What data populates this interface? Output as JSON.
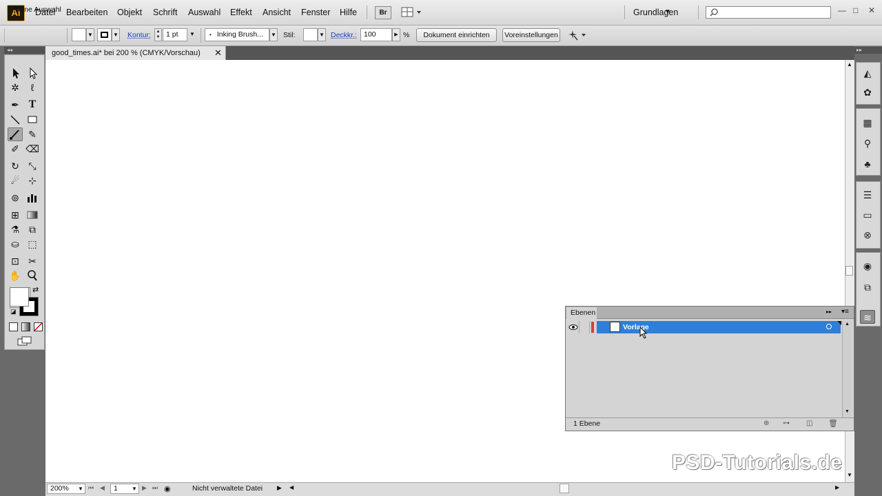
{
  "app": {
    "logo": "Ai"
  },
  "menu": [
    "Datei",
    "Bearbeiten",
    "Objekt",
    "Schrift",
    "Auswahl",
    "Effekt",
    "Ansicht",
    "Fenster",
    "Hilfe"
  ],
  "header": {
    "bridge_label": "Br",
    "workspace": "Grundlagen",
    "search_placeholder": ""
  },
  "controlbar": {
    "selection": "Keine Auswahl",
    "stroke_label": "Kontur:",
    "stroke_weight": "1 pt",
    "brush": "Inking Brush...",
    "style_label": "Stil:",
    "opacity_label": "Deckkr.:",
    "opacity_value": "100",
    "percent": "%",
    "doc_setup": "Dokument einrichten",
    "preferences": "Voreinstellungen"
  },
  "document": {
    "tab_title": "good_times.ai* bei 200 % (CMYK/Vorschau)",
    "close": "✕"
  },
  "statusbar": {
    "zoom": "200%",
    "artboard": "1",
    "status": "Nicht verwaltete Datei"
  },
  "layers_panel": {
    "tab": "Ebenen",
    "layers": [
      {
        "name": "Vorlage",
        "visible": true,
        "color": "#e03a3a"
      }
    ],
    "count": "1 Ebene"
  },
  "watermark": "PSD-Tutorials.de",
  "colors": {
    "selection_blue": "#2f7fd8",
    "layer_color": "#e03a3a"
  }
}
